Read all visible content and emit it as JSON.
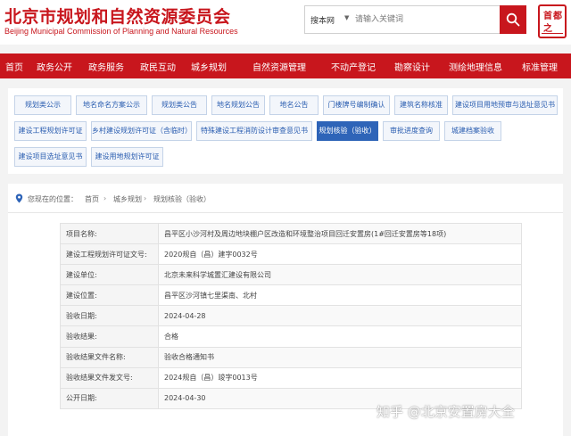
{
  "header": {
    "title_cn": "北京市规划和自然资源委员会",
    "title_en": "Beijing Municipal Commission of Planning and Natural Resources",
    "seal_chars": [
      "首",
      "都",
      "之"
    ],
    "brand_color": "#c8161d"
  },
  "search": {
    "scope": "搜本网",
    "placeholder": "请输入关键词",
    "button_icon": "search-icon"
  },
  "nav": {
    "items": [
      "首页",
      "政务公开",
      "政务服务",
      "政民互动",
      "城乡规划",
      "自然资源管理",
      "不动产登记",
      "勘察设计",
      "测绘地理信息",
      "标准管理"
    ]
  },
  "tags": {
    "active_index": 12,
    "active_color": "#2e64b8",
    "items": [
      "规划类公示",
      "地名命名方案公示",
      "规划类公告",
      "地名规划公告",
      "地名公告",
      "门楼牌号编制确认",
      "建筑名称核准",
      "建设项目用地预审与选址意见书",
      "建设工程规划许可证",
      "乡村建设规划许可证（含临时）",
      "特殊建设工程消防设计审查意见书",
      "规划核验（验收）",
      "审批进度查询",
      "城建档案验收",
      "建设项目选址意见书",
      "建设用地规划许可证"
    ]
  },
  "breadcrumb": {
    "prefix": "您现在的位置：",
    "items": [
      "首页",
      "城乡规划",
      "规划核验（验收）"
    ],
    "separator": "›"
  },
  "record": {
    "rows": [
      {
        "label": "项目名称:",
        "value": "昌平区小沙河村及周边地块棚户区改造和环境整治项目回迁安置房(1#回迁安置房等18项)"
      },
      {
        "label": "建设工程规划许可证文号:",
        "value": "2020规自（昌）建字0032号"
      },
      {
        "label": "建设单位:",
        "value": "北京未来科学城置汇建设有限公司"
      },
      {
        "label": "建设位置:",
        "value": "昌平区沙河镇七里渠南、北村"
      },
      {
        "label": "验收日期:",
        "value": "2024-04-28"
      },
      {
        "label": "验收结果:",
        "value": "合格"
      },
      {
        "label": "验收结果文件名称:",
        "value": "验收合格通知书"
      },
      {
        "label": "验收结果文件发文号:",
        "value": "2024规自（昌）竣字0013号"
      },
      {
        "label": "公开日期:",
        "value": "2024-04-30"
      }
    ]
  },
  "watermark": {
    "text": "知乎 @北京安置房大全"
  }
}
